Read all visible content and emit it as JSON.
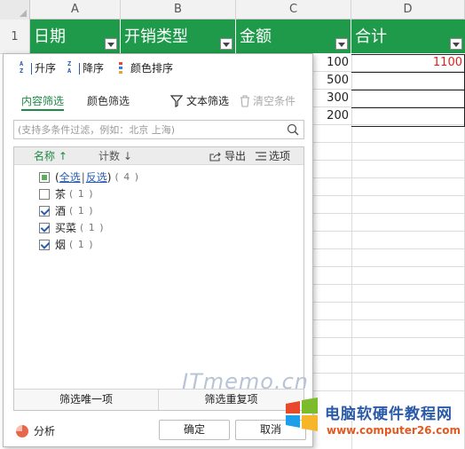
{
  "sheet": {
    "columns": [
      "A",
      "B",
      "C",
      "D"
    ],
    "row1_number": "1",
    "headers": [
      "日期",
      "开销类型",
      "金额",
      "合计"
    ],
    "amounts": [
      "100",
      "500",
      "300",
      "200"
    ],
    "total": "1100",
    "header_color": "#1e9a4a",
    "total_color": "#d22222"
  },
  "popup": {
    "sort": {
      "ascending": "升序",
      "descending": "降序",
      "color_sort": "颜色排序"
    },
    "tabs": {
      "content_filter": "内容筛选",
      "color_filter": "颜色筛选"
    },
    "text_filter": "文本筛选",
    "clear_conditions": "清空条件",
    "search": {
      "placeholder": "(支持多条件过滤，例如：北京 上海)"
    },
    "list_header": {
      "name": "名称 ↑",
      "count": "计数 ↓",
      "export": "导出",
      "options": "选项"
    },
    "select_all": {
      "all_label": "全选",
      "invert_label": "反选",
      "count": "( 4 )"
    },
    "items": [
      {
        "label": "茶",
        "count": "( 1 )",
        "checked": false
      },
      {
        "label": "酒",
        "count": "( 1 )",
        "checked": true
      },
      {
        "label": "买菜",
        "count": "( 1 )",
        "checked": true
      },
      {
        "label": "烟",
        "count": "( 1 )",
        "checked": true
      }
    ],
    "buttons": {
      "unique": "筛选唯一项",
      "duplicate": "筛选重复项"
    },
    "footer": {
      "analysis": "分析",
      "ok": "确定",
      "cancel": "取消"
    },
    "accent_color": "#1e8a45"
  },
  "watermarks": {
    "itmemo": "ITmemo.cn",
    "site_name": "电脑软硬件教程网",
    "site_url": "www.computer26.com"
  }
}
